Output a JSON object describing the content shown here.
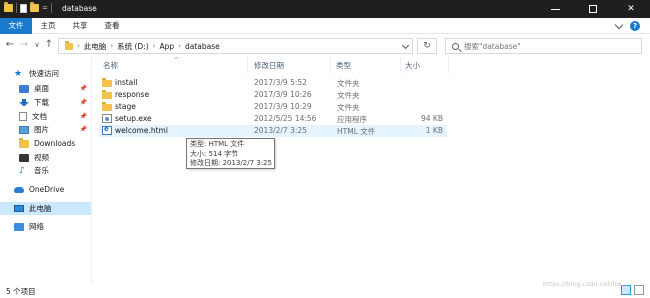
{
  "window": {
    "title": "database",
    "controls": {
      "minimize": "—",
      "maximize": "☐",
      "close": "✕"
    }
  },
  "ribbon": {
    "tabs": [
      "文件",
      "主页",
      "共享",
      "查看"
    ]
  },
  "nav": {
    "back": "←",
    "forward": "→",
    "recent": "∨",
    "up": "↑",
    "breadcrumb": [
      "此电脑",
      "系统 (D:)",
      "App",
      "database"
    ],
    "refresh": "↻",
    "search_placeholder": "搜索\"database\""
  },
  "sidebar": {
    "items": [
      {
        "label": "快速访问",
        "icon": "star-icon"
      },
      {
        "label": "桌面",
        "icon": "desktop-icon",
        "pinned": true
      },
      {
        "label": "下载",
        "icon": "download-icon",
        "pinned": true
      },
      {
        "label": "文档",
        "icon": "document-icon",
        "pinned": true
      },
      {
        "label": "图片",
        "icon": "picture-icon",
        "pinned": true
      },
      {
        "label": "Downloads",
        "icon": "folder-icon"
      },
      {
        "label": "视频",
        "icon": "video-icon"
      },
      {
        "label": "音乐",
        "icon": "music-icon"
      },
      {
        "label": "OneDrive",
        "icon": "cloud-icon"
      },
      {
        "label": "此电脑",
        "icon": "computer-icon",
        "selected": true
      },
      {
        "label": "网络",
        "icon": "network-icon"
      }
    ]
  },
  "columns": {
    "name": "名称",
    "modified": "修改日期",
    "type": "类型",
    "size": "大小"
  },
  "files": [
    {
      "name": "install",
      "modified": "2017/3/9 5:52",
      "type": "文件夹",
      "size": "",
      "kind": "folder"
    },
    {
      "name": "response",
      "modified": "2017/3/9 10:26",
      "type": "文件夹",
      "size": "",
      "kind": "folder"
    },
    {
      "name": "stage",
      "modified": "2017/3/9 10:29",
      "type": "文件夹",
      "size": "",
      "kind": "folder"
    },
    {
      "name": "setup.exe",
      "modified": "2012/5/25 14:56",
      "type": "应用程序",
      "size": "94 KB",
      "kind": "exe"
    },
    {
      "name": "welcome.html",
      "modified": "2013/2/7 3:25",
      "type": "HTML 文件",
      "size": "1 KB",
      "kind": "html"
    }
  ],
  "tooltip": {
    "type": "类型: HTML 文件",
    "size": "大小: 514 字节",
    "modified": "修改日期: 2013/2/7 3:25"
  },
  "status": {
    "count": "5 个项目"
  },
  "watermark": "https://blog.csdn.net/liw..."
}
